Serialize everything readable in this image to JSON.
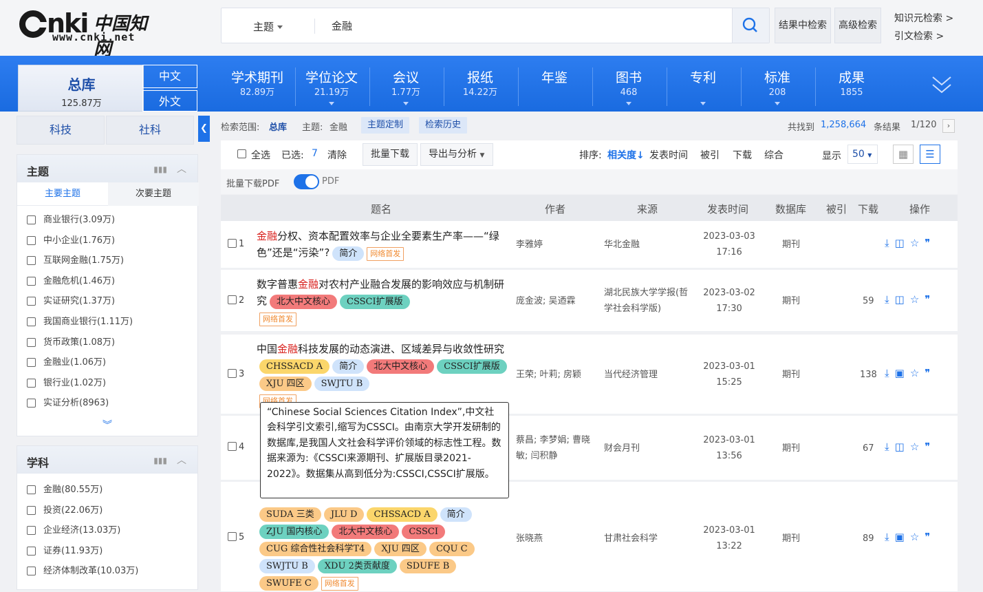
{
  "header": {
    "logo_en": "www.cnki.net",
    "logo_zh": "中国知网",
    "logo_brand": "nki",
    "search_field": "主题",
    "search_value": "金融",
    "btn_in_result": "结果中检索",
    "btn_advanced": "高级检索",
    "link_knowledge": "知识元检索  >",
    "link_cite": "引文检索  >"
  },
  "nav": {
    "total_label": "总库",
    "total_count": "125.87万",
    "lang_zh": "中文",
    "lang_en": "外文",
    "items": [
      {
        "label": "学术期刊",
        "count": "82.89万"
      },
      {
        "label": "学位论文",
        "count": "21.19万"
      },
      {
        "label": "会议",
        "count": "1.77万"
      },
      {
        "label": "报纸",
        "count": "14.22万"
      },
      {
        "label": "年鉴",
        "count": ""
      },
      {
        "label": "图书",
        "count": "468"
      },
      {
        "label": "专利",
        "count": ""
      },
      {
        "label": "标准",
        "count": "208"
      },
      {
        "label": "成果",
        "count": "1855"
      }
    ]
  },
  "sidebar": {
    "tab_sci": "科技",
    "tab_soc": "社科",
    "topic": {
      "title": "主题",
      "sub_main": "主要主题",
      "sub_second": "次要主题",
      "items": [
        "商业银行(3.09万)",
        "中小企业(1.76万)",
        "互联网金融(1.75万)",
        "金融危机(1.46万)",
        "实证研究(1.37万)",
        "我国商业银行(1.11万)",
        "货币政策(1.08万)",
        "金融业(1.06万)",
        "银行业(1.02万)",
        "实证分析(8963)"
      ]
    },
    "subject": {
      "title": "学科",
      "items": [
        "金融(80.55万)",
        "投资(22.06万)",
        "企业经济(13.03万)",
        "证券(11.93万)",
        "经济体制改革(10.03万)"
      ]
    }
  },
  "crumb": {
    "scope_label": "检索范围:",
    "scope_value": "总库",
    "topic_label": "主题:",
    "topic_value": "金融",
    "btn_custom": "主题定制",
    "btn_history": "检索历史",
    "found_pre": "共找到",
    "found_count": "1,258,664",
    "found_post": "条结果",
    "page": "1/120"
  },
  "toolbar": {
    "select_all": "全选",
    "selected_label": "已选:",
    "selected_count": "7",
    "clear": "清除",
    "batch_download": "批量下载",
    "export": "导出与分析",
    "sort_label": "排序:",
    "sort_relevance": "相关度",
    "sort_time": "发表时间",
    "sort_cited": "被引",
    "sort_download": "下载",
    "sort_overall": "综合",
    "display_label": "显示",
    "display_value": "50"
  },
  "pdfbar": {
    "label": "批量下载PDF",
    "toggle_label": "PDF"
  },
  "table": {
    "headers": {
      "title": "题名",
      "author": "作者",
      "source": "来源",
      "date": "发表时间",
      "db": "数据库",
      "cited": "被引",
      "download": "下载",
      "ops": "操作"
    },
    "rows": [
      {
        "num": "1",
        "title_hl": "金融",
        "title_rest": "分权、资本配置效率与企业全要素生产率——“绿色”还是“污染”?",
        "author": "李雅婷",
        "source": "华北金融",
        "date": "2023-03-03",
        "time": "17:16",
        "db": "期刊",
        "cited": "",
        "download": ""
      },
      {
        "num": "2",
        "title_pre": "数字普惠",
        "title_hl": "金融",
        "title_rest": "对农村产业融合发展的影响效应与机制研究",
        "author": "庞金波; 吴迺霖",
        "source": "湖北民族大学学报(哲学社会科学版)",
        "date": "2023-03-02",
        "time": "17:30",
        "db": "期刊",
        "cited": "",
        "download": "59"
      },
      {
        "num": "3",
        "title_pre": "中国",
        "title_hl": "金融",
        "title_rest": "科技发展的动态演进、区域差异与收敛性研究",
        "author": "王荣; 叶莉; 房颖",
        "source": "当代经济管理",
        "date": "2023-03-01",
        "time": "15:25",
        "db": "期刊",
        "cited": "",
        "download": "138"
      },
      {
        "num": "4",
        "title_rest": "",
        "author": "蔡昌; 李梦娟; 曹晓敏; 闫积静",
        "source": "财会月刊",
        "date": "2023-03-01",
        "time": "13:56",
        "db": "期刊",
        "cited": "",
        "download": "67"
      },
      {
        "num": "5",
        "title_rest": "",
        "author": "张晓燕",
        "source": "甘肃社会科学",
        "date": "2023-03-01",
        "time": "13:22",
        "db": "期刊",
        "cited": "",
        "download": "89"
      }
    ]
  },
  "tags": {
    "intro": "简介",
    "net_first": "网络首发",
    "pku": "北大中文核心",
    "cssci_ext": "CSSCI扩展版",
    "chssacd": "CHSSACD A",
    "xju": "XJU 四区",
    "swjtu": "SWJTU B",
    "suda": "SUDA 三类",
    "jlu": "JLU D",
    "zju": "ZJU 国内核心",
    "cssci": "CSSCI",
    "cug": "CUG 综合性社会科学T4",
    "cqu": "CQU C",
    "xdu": "XDU 2类贡献度",
    "sdufe": "SDUFE B",
    "swufe": "SWUFE C"
  },
  "tooltip": "“Chinese Social Sciences Citation Index”,中文社会科学引文索引,缩写为CSSCI。由南京大学开发研制的数据库,是我国人文社会科学评价领域的标志性工程。数据来源为:《CSSCI来源期刊、扩展版目录2021-2022》。数据集从高到低分为:CSSCI,CSSCI扩展版。"
}
